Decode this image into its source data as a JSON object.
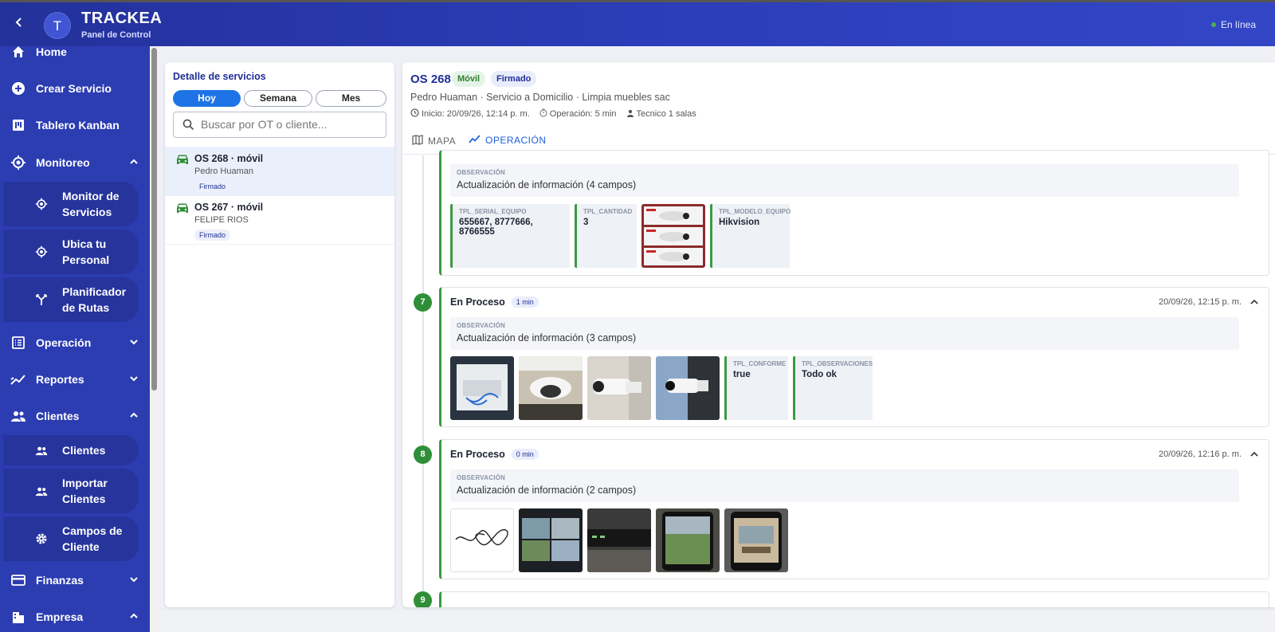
{
  "header": {
    "avatar_letter": "T",
    "brand": "TRACKEA",
    "subtitle": "Panel de Control",
    "status": "En línea"
  },
  "sidebar": {
    "items": [
      {
        "label": "Home",
        "icon": "home-icon"
      },
      {
        "label": "Crear Servicio",
        "icon": "add-circle-icon"
      },
      {
        "label": "Tablero Kanban",
        "icon": "kanban-icon"
      },
      {
        "label": "Monitoreo",
        "icon": "target-icon",
        "expanded": true
      },
      {
        "label": "Operación",
        "icon": "list-icon",
        "expanded": false
      },
      {
        "label": "Reportes",
        "icon": "trend-icon",
        "expanded": false
      },
      {
        "label": "Clientes",
        "icon": "people-icon",
        "expanded": true
      },
      {
        "label": "Finanzas",
        "icon": "card-icon",
        "expanded": false
      },
      {
        "label": "Empresa",
        "icon": "building-icon",
        "expanded": true
      }
    ],
    "monitoreo_sub": [
      {
        "l1": "Monitor de",
        "l2": "Servicios"
      },
      {
        "l1": "Ubica tu",
        "l2": "Personal"
      },
      {
        "l1": "Planificador",
        "l2": "de Rutas"
      }
    ],
    "clientes_sub": [
      {
        "l1": "Clientes",
        "l2": ""
      },
      {
        "l1": "Importar",
        "l2": "Clientes"
      },
      {
        "l1": "Campos de",
        "l2": "Cliente"
      }
    ]
  },
  "left_panel": {
    "title": "Detalle de servicios",
    "filters": [
      "Hoy",
      "Semana",
      "Mes"
    ],
    "active_filter": "Hoy",
    "search_placeholder": "Buscar por OT o cliente...",
    "services": [
      {
        "title": "OS 268 · móvil",
        "client": "Pedro Huaman",
        "status": "Firmado",
        "active": true
      },
      {
        "title": "OS 267 · móvil",
        "client": "FELIPE RIOS",
        "status": "Firmado",
        "active": false
      }
    ]
  },
  "detail": {
    "title": "OS 268",
    "badge_mode": "Móvil",
    "badge_status": "Firmado",
    "subtitle": "Pedro Huaman · Servicio a Domicilio · Limpia muebles sac",
    "meta_start": "Inicio: 20/09/26, 12:14 p. m.",
    "meta_operation": "Operación: 5 min",
    "meta_tech": "Tecnico 1 salas",
    "tabs": [
      "MAPA",
      "OPERACIÓN"
    ],
    "active_tab": "OPERACIÓN",
    "obs_key": "OBSERVACIÓN",
    "cards": [
      {
        "obs": "Actualización de información (4 campos)",
        "fields": [
          {
            "k": "TPL_SERIAL_EQUIPO",
            "v": "655667, 8777666, 8766555"
          },
          {
            "k": "TPL_CANTIDAD",
            "v": "3"
          },
          {
            "k": "TPL_MODELO_EQUIPO",
            "v": "Hikvision"
          }
        ]
      },
      {
        "step": "7",
        "title": "En Proceso",
        "duration": "1 min",
        "date": "20/09/26, 12:15 p. m.",
        "obs": "Actualización de información (3 campos)",
        "fields": [
          {
            "k": "TPL_CONFORME",
            "v": "true"
          },
          {
            "k": "TPL_OBSERVACIONES",
            "v": "Todo ok"
          }
        ]
      },
      {
        "step": "8",
        "title": "En Proceso",
        "duration": "0 min",
        "date": "20/09/26, 12:16 p. m.",
        "obs": "Actualización de información (2 campos)"
      }
    ],
    "next_step": "9"
  },
  "colors": {
    "header": "#2b3db8",
    "sidebar": "#2c3db2",
    "accent": "#1e74e6",
    "success": "#3a9a42"
  }
}
